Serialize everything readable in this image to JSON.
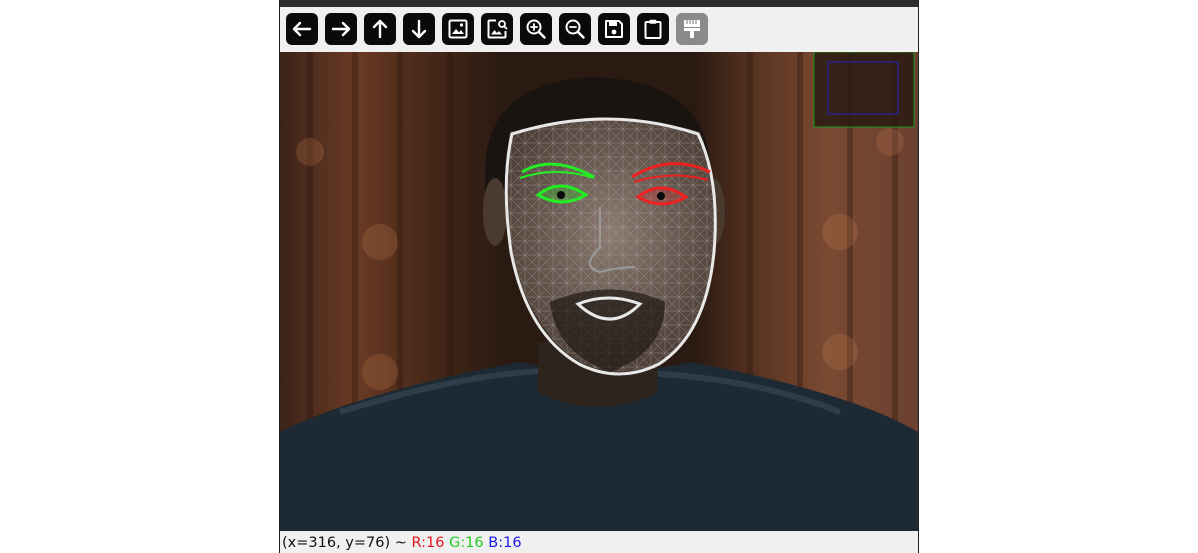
{
  "toolbar": {
    "buttons": [
      {
        "name": "pan-left-button",
        "icon": "arrow-left-icon"
      },
      {
        "name": "pan-right-button",
        "icon": "arrow-right-icon"
      },
      {
        "name": "pan-up-button",
        "icon": "arrow-up-icon"
      },
      {
        "name": "pan-down-button",
        "icon": "arrow-down-icon"
      },
      {
        "name": "zoom-fit-button",
        "icon": "image-icon"
      },
      {
        "name": "zoom-original-button",
        "icon": "image-search-icon"
      },
      {
        "name": "zoom-in-button",
        "icon": "zoom-in-icon"
      },
      {
        "name": "zoom-out-button",
        "icon": "zoom-out-icon"
      },
      {
        "name": "save-image-button",
        "icon": "floppy-disk-icon"
      },
      {
        "name": "copy-clipboard-button",
        "icon": "clipboard-icon"
      },
      {
        "name": "properties-button",
        "icon": "paint-roller-icon",
        "disabled": true
      }
    ]
  },
  "status": {
    "coords": "(x=316, y=76) ~",
    "r": "R:16",
    "g": "G:16",
    "b": "B:16"
  },
  "colors": {
    "status_r": "#e0141e",
    "status_g": "#22cc22",
    "status_b": "#1a1aee",
    "left_eye_overlay": "#22ee22",
    "right_eye_overlay": "#ee2020",
    "face_outline": "#e8e8e8",
    "mesh": "#b0b0b0"
  }
}
